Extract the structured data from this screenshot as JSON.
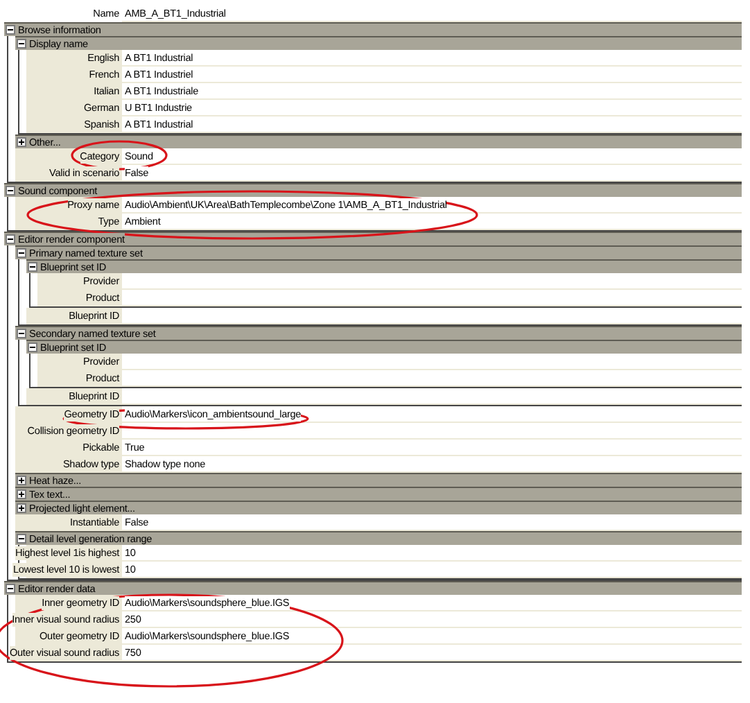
{
  "name": {
    "label": "Name",
    "value": "AMB_A_BT1_Industrial"
  },
  "tree": [
    {
      "kind": "section",
      "title": "Browse information",
      "expanded": true,
      "children": [
        {
          "kind": "section",
          "title": "Display name",
          "expanded": true,
          "children": [
            {
              "kind": "property",
              "label": "English",
              "value": "A BT1 Industrial"
            },
            {
              "kind": "property",
              "label": "French",
              "value": "A BT1 Industriel"
            },
            {
              "kind": "property",
              "label": "Italian",
              "value": "A BT1 Industriale"
            },
            {
              "kind": "property",
              "label": "German",
              "value": "U BT1 Industrie"
            },
            {
              "kind": "property",
              "label": "Spanish",
              "value": "A BT1 Industrial"
            }
          ]
        },
        {
          "kind": "section",
          "title": "Other...",
          "expanded": false
        },
        {
          "kind": "property",
          "label": "Category",
          "value": "Sound"
        },
        {
          "kind": "property",
          "label": "Valid in scenario",
          "value": "False"
        }
      ]
    },
    {
      "kind": "section",
      "title": "Sound component",
      "expanded": true,
      "children": [
        {
          "kind": "property",
          "label": "Proxy name",
          "value": "Audio\\Ambient\\UK\\Area\\BathTemplecombe\\Zone 1\\AMB_A_BT1_Industrial"
        },
        {
          "kind": "property",
          "label": "Type",
          "value": "Ambient"
        }
      ]
    },
    {
      "kind": "section",
      "title": "Editor render component",
      "expanded": true,
      "children": [
        {
          "kind": "section",
          "title": "Primary named texture set",
          "expanded": true,
          "children": [
            {
              "kind": "section",
              "title": "Blueprint set ID",
              "expanded": true,
              "children": [
                {
                  "kind": "property",
                  "label": "Provider"
                },
                {
                  "kind": "property",
                  "label": "Product"
                }
              ]
            },
            {
              "kind": "property",
              "label": "Blueprint ID"
            }
          ]
        },
        {
          "kind": "section",
          "title": "Secondary named texture set",
          "expanded": true,
          "children": [
            {
              "kind": "section",
              "title": "Blueprint set ID",
              "expanded": true,
              "children": [
                {
                  "kind": "property",
                  "label": "Provider"
                },
                {
                  "kind": "property",
                  "label": "Product"
                }
              ]
            },
            {
              "kind": "property",
              "label": "Blueprint ID"
            }
          ]
        },
        {
          "kind": "property",
          "label": "Geometry ID",
          "value": "Audio\\Markers\\icon_ambientsound_large"
        },
        {
          "kind": "property",
          "label": "Collision geometry ID"
        },
        {
          "kind": "property",
          "label": "Pickable",
          "value": "True"
        },
        {
          "kind": "property",
          "label": "Shadow type",
          "value": "Shadow type none"
        },
        {
          "kind": "section",
          "title": "Heat haze...",
          "expanded": false
        },
        {
          "kind": "section",
          "title": "Tex text...",
          "expanded": false
        },
        {
          "kind": "section",
          "title": "Projected light element...",
          "expanded": false
        },
        {
          "kind": "property",
          "label": "Instantiable",
          "value": "False"
        },
        {
          "kind": "section",
          "title": "Detail level generation range",
          "expanded": true,
          "children": [
            {
              "kind": "property",
              "label": "Highest level 1is highest",
              "value": "10"
            },
            {
              "kind": "property",
              "label": "Lowest level 10 is lowest",
              "value": "10"
            }
          ]
        }
      ]
    },
    {
      "kind": "section",
      "title": "Editor render data",
      "expanded": true,
      "children": [
        {
          "kind": "property",
          "label": "Inner geometry ID",
          "value": "Audio\\Markers\\soundsphere_blue.IGS"
        },
        {
          "kind": "property",
          "label": "Inner visual sound radius",
          "value": "250"
        },
        {
          "kind": "property",
          "label": "Outer geometry ID",
          "value": "Audio\\Markers\\soundsphere_blue.IGS"
        },
        {
          "kind": "property",
          "label": "Outer visual sound radius",
          "value": "750"
        }
      ]
    }
  ]
}
